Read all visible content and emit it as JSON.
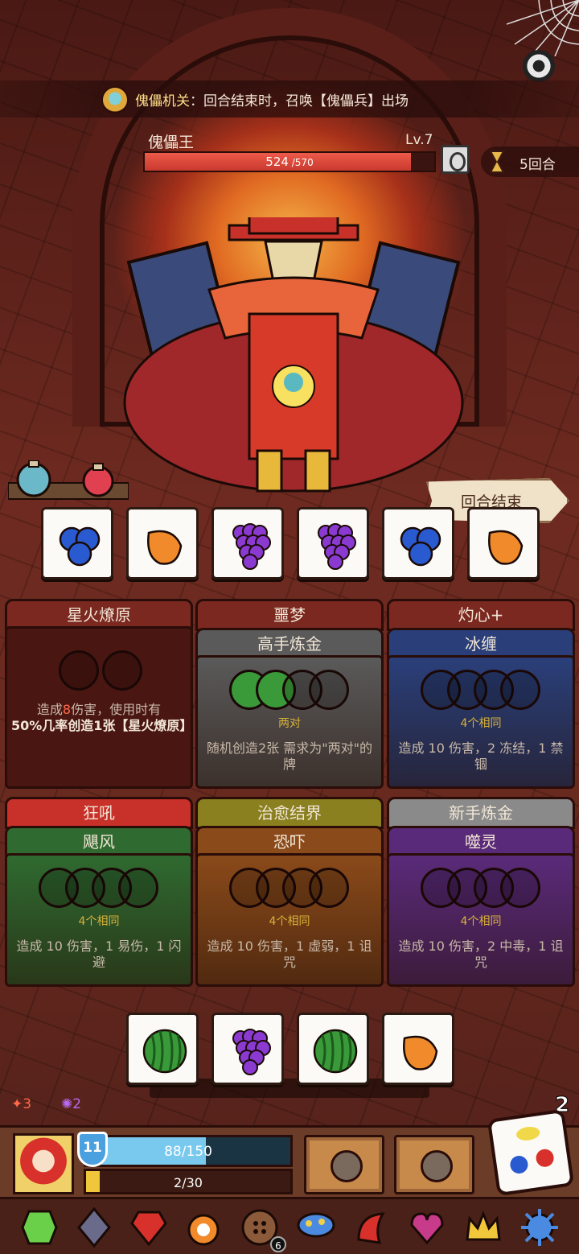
{
  "boss": {
    "ability_name": "傀儡机关",
    "ability_desc": "：回合结束时，召唤【傀儡兵】出场",
    "name": "傀儡王",
    "level": "Lv.7",
    "hp_current": "524",
    "hp_max": " /570",
    "hp_fraction": 0.919
  },
  "turn": {
    "label": "5回合"
  },
  "end_turn": {
    "label": "回合结束"
  },
  "rolled_dice": [
    "blueberry-icon",
    "orange-icon",
    "grape-icon",
    "grape-icon",
    "blueberry-icon",
    "orange-icon"
  ],
  "cards": [
    {
      "title": "星火燎原",
      "top_color": "#7a2820",
      "sub": null,
      "slots": 2,
      "requirement": "",
      "desc_pre": "造成",
      "desc_val": "8",
      "desc_post": "伤害，使用时有",
      "desc2": "50%几率创造1张【星火燎原】"
    },
    {
      "title": "噩梦",
      "top_color": "#7a2820",
      "sub": "高手炼金",
      "sub_color": "#5a5a5a",
      "slots": 4,
      "requirement": "两对",
      "desc": "随机创造2张 需求为\"两对\"的牌"
    },
    {
      "title": "灼心+",
      "top_color": "#7a2820",
      "sub": "冰缠",
      "sub_color": "#2a3f7a",
      "slots": 4,
      "requirement": "4个相同",
      "desc": "造成 10 伤害，2 冻结，1 禁锢"
    },
    {
      "title": "狂吼",
      "top_color": "#c8302a",
      "sub": "飓风",
      "sub_color": "#2f6a30",
      "slots": 4,
      "requirement": "4个相同",
      "desc": "造成 10 伤害，1 易伤，1 闪避"
    },
    {
      "title": "治愈结界",
      "top_color": "#8a8020",
      "sub": "恐吓",
      "sub_color": "#8a4a1a",
      "slots": 4,
      "requirement": "4个相同",
      "desc": "造成 10 伤害，1 虚弱，1 诅咒"
    },
    {
      "title": "新手炼金",
      "top_color": "#8a8a8a",
      "sub": "噬灵",
      "sub_color": "#5a2a7a",
      "slots": 4,
      "requirement": "4个相同",
      "desc": "造成 10 伤害，2 中毒，1 诅咒"
    }
  ],
  "hand_dice": [
    "watermelon-icon",
    "grape-icon",
    "watermelon-icon",
    "orange-icon"
  ],
  "status": {
    "rage": "3",
    "spirit": "2"
  },
  "player": {
    "shield": "11",
    "hp": "88/150",
    "hp_fraction": 0.587,
    "exp": "2/30",
    "exp_fraction": 0.067,
    "dice_count": "2"
  },
  "inventory": {
    "badge": "6"
  },
  "colors": {
    "hp_red": "#e04a3a",
    "req_gold": "#d8b23a",
    "shield_blue": "#4ba0e0"
  }
}
